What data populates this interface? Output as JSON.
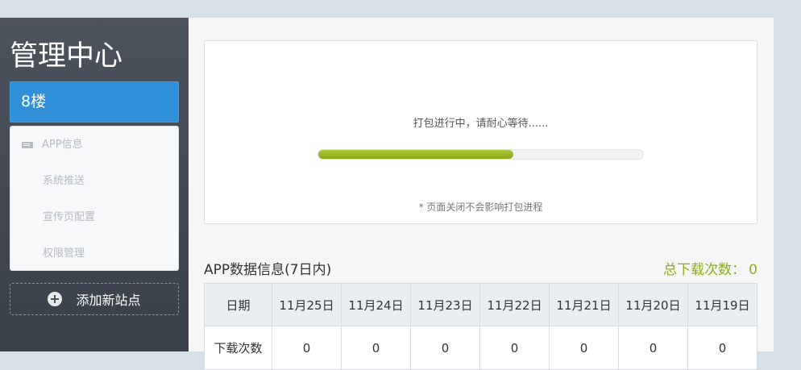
{
  "sidebar": {
    "brand": "管理中心",
    "current_site": "8楼",
    "menu": [
      {
        "label": "APP信息",
        "icon": "card-icon"
      },
      {
        "label": "系统推送"
      },
      {
        "label": "宣传页配置"
      },
      {
        "label": "权限管理"
      }
    ],
    "add_site_label": "添加新站点"
  },
  "progress": {
    "message": "打包进行中，请耐心等待......",
    "percent": 60,
    "note": "* 页面关闭不会影响打包进程"
  },
  "stats": {
    "title": "APP数据信息(7日内)",
    "total_label": "总下载次数：",
    "total_value": "0",
    "header_first": "日期",
    "dates": [
      "11月25日",
      "11月24日",
      "11月23日",
      "11月22日",
      "11月21日",
      "11月20日",
      "11月19日"
    ],
    "row_label": "下载次数",
    "row_values": [
      "0",
      "0",
      "0",
      "0",
      "0",
      "0",
      "0"
    ]
  },
  "colors": {
    "accent_blue": "#2f8fd8",
    "progress_green": "#99b727",
    "total_green": "#8cae1c",
    "sidebar_bg": "#434a54"
  }
}
